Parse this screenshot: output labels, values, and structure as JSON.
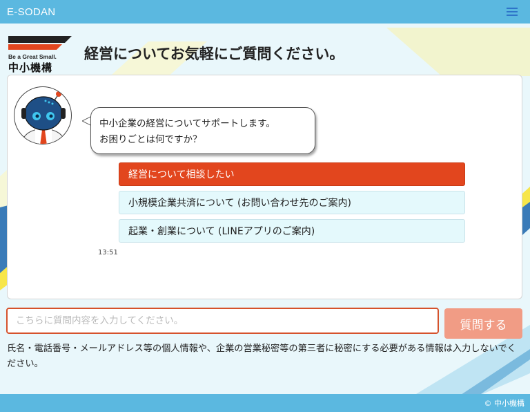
{
  "header": {
    "title": "E-SODAN",
    "menu_icon": "hamburger-menu-icon"
  },
  "logo": {
    "tagline": "Be a Great Small.",
    "name": "中小機構"
  },
  "page_title": "経営についてお気軽にご質問ください。",
  "chat": {
    "bot_message_line1": "中小企業の経営についてサポートします。",
    "bot_message_line2": "お困りごとは何ですか？",
    "options": [
      {
        "label": "経営について相談したい",
        "selected": true
      },
      {
        "label": "小規模企業共済について (お問い合わせ先のご案内)",
        "selected": false
      },
      {
        "label": "起業・創業について (LINEアプリのご案内)",
        "selected": false
      }
    ],
    "timestamp": "13:51"
  },
  "input": {
    "placeholder": "こちらに質問内容を入力してください。",
    "value": ""
  },
  "submit": {
    "label": "質問する"
  },
  "notice": "氏名・電話番号・メールアドレス等の個人情報や、企業の営業秘密等の第三者に秘密にする必要がある情報は入力しないでください。",
  "footer": {
    "copyright": "© 中小機構"
  },
  "colors": {
    "header_bg": "#5bb8e0",
    "primary_option": "#e2461e",
    "secondary_option": "#e4f9fc",
    "submit_button": "#f19c85",
    "input_border": "#d5522c",
    "page_bg": "#e9f7fb"
  }
}
